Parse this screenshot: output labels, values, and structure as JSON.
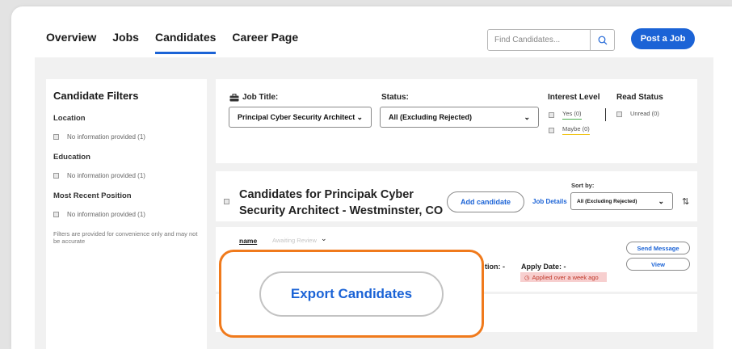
{
  "nav": {
    "tabs": [
      {
        "label": "Overview"
      },
      {
        "label": "Jobs"
      },
      {
        "label": "Candidates",
        "active": true
      },
      {
        "label": "Career Page"
      }
    ]
  },
  "search": {
    "placeholder": "Find Candidates...",
    "icon": "search-icon"
  },
  "post_job_label": "Post a Job",
  "filters": {
    "title": "Candidate Filters",
    "sections": [
      {
        "label": "Location",
        "option": "No information provided (1)"
      },
      {
        "label": "Education",
        "option": "No information provided (1)"
      },
      {
        "label": "Most Recent Position",
        "option": "No information provided (1)"
      }
    ],
    "note": "Filters are provided for convenience only and may not be accurate"
  },
  "job_panel": {
    "job_title_label": "Job Title:",
    "job_title_value": "Principal Cyber Security Architect",
    "status_label": "Status:",
    "status_value": "All (Excluding Rejected)",
    "interest_label": "Interest Level",
    "interest_options": [
      "Yes (0)",
      "Maybe (0)"
    ],
    "read_status_label": "Read Status",
    "read_option": "Unread (0)"
  },
  "candidates_header": {
    "title": "Candidates for Principak Cyber Security Architect - Westminster, CO",
    "add_candidate": "Add candidate",
    "job_details": "Job Details",
    "sort_label": "Sort by:",
    "sort_value": "All (Excluding Rejected)"
  },
  "candidate_row": {
    "name": "name",
    "stage": "Awaiting Review",
    "location_suffix": "tion: -",
    "apply_date": "Apply Date: -",
    "applied_note": "Applied over a week ago",
    "send_message": "Send Message",
    "view": "View"
  },
  "export_label": "Export Candidates",
  "colors": {
    "accent": "#1b63d6",
    "highlight": "#f07a1c",
    "badge_bg": "#f7cfcf"
  }
}
